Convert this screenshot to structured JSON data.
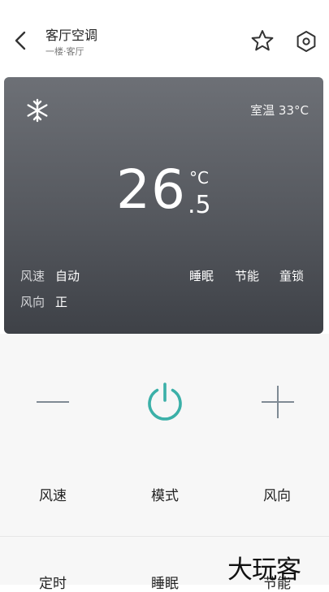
{
  "header": {
    "title": "客厅空调",
    "subtitle": "一楼·客厅",
    "icons": [
      "back-chevron-icon",
      "star-icon",
      "hexagon-settings-icon"
    ]
  },
  "status": {
    "mode_icon": "snowflake-icon",
    "room_temp_label": "室温 33°C",
    "set_temp_int": "26",
    "set_temp_dec": ".5",
    "unit": "°C",
    "fan_speed_label": "风速",
    "fan_speed_value": "自动",
    "airflow_label": "风向",
    "airflow_value": "正",
    "features": [
      "睡眠",
      "节能",
      "童锁"
    ]
  },
  "controls": {
    "minus_icon": "minus-icon",
    "power_icon": "power-icon",
    "plus_icon": "plus-icon",
    "accent_color": "#3bb0a8",
    "buttons": [
      "风速",
      "模式",
      "风向",
      "定时",
      "睡眠",
      "节能"
    ]
  },
  "watermark": "大玩客",
  "colors": {
    "card_top": "#6d7076",
    "card_bottom": "#3e4147",
    "power": "#3bb0a8"
  }
}
